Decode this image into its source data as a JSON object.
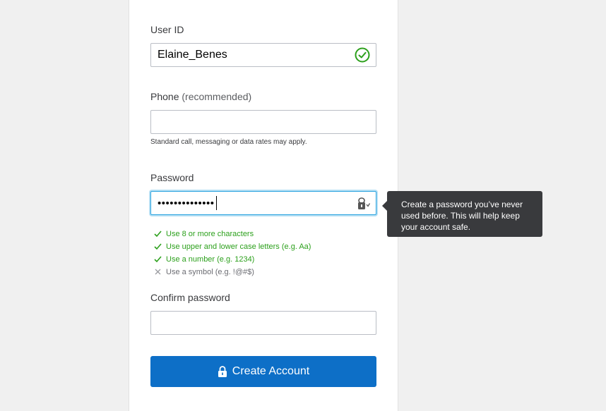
{
  "form": {
    "user_id": {
      "label": "User ID",
      "value": "Elaine_Benes",
      "status_icon": "check-circle-icon",
      "status_color": "#2ca01c"
    },
    "phone": {
      "label": "Phone",
      "label_suffix": "(recommended)",
      "value": "",
      "hint": "Standard call, messaging or data rates may apply."
    },
    "password": {
      "label": "Password",
      "masked_value": "••••••••••••••",
      "toggle_icon": "key-icon",
      "tooltip": "Create a password you’ve never used before. This will help keep your account safe.",
      "rules": [
        {
          "text": "Use 8 or more characters",
          "met": true
        },
        {
          "text": "Use upper and lower case letters (e.g. Aa)",
          "met": true
        },
        {
          "text": "Use a number (e.g. 1234)",
          "met": true
        },
        {
          "text": "Use a symbol (e.g. !@#$)",
          "met": false
        }
      ]
    },
    "confirm_password": {
      "label": "Confirm password",
      "value": ""
    },
    "submit": {
      "label": "Create Account",
      "icon": "lock-icon",
      "color": "#0d6fc7"
    }
  },
  "colors": {
    "success": "#2ca01c",
    "focus": "#2ca4e0",
    "tooltip_bg": "#393a3d"
  }
}
